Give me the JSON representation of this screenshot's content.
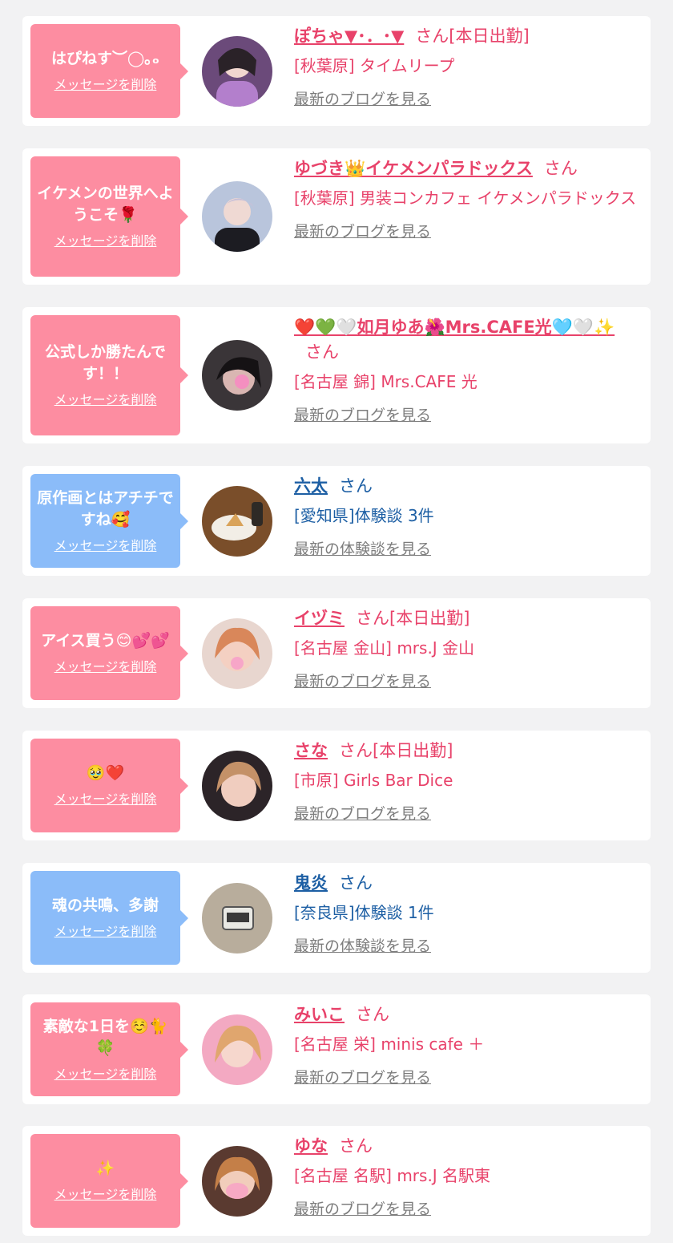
{
  "entries": [
    {
      "message": "はぴねす︶◯｡ₒ",
      "delete_label": "メッセージを削除",
      "name": "ぽちゃ▼･．･▼",
      "suffix": "さん[本日出勤]",
      "shop": "[秋葉原] タイムリープ",
      "link": "最新のブログを見る",
      "theme": "pink"
    },
    {
      "message": "イケメンの世界へようこそ🌹",
      "delete_label": "メッセージを削除",
      "name": "ゆづき👑イケメンパラドックス",
      "suffix": "さん",
      "shop": "[秋葉原] 男装コンカフェ イケメンパラドックス",
      "link": "最新のブログを見る",
      "theme": "pink"
    },
    {
      "message": "公式しか勝たんです！！",
      "delete_label": "メッセージを削除",
      "name": "❤️💚🤍如月ゆあ🌺Mrs.CAFE光🩵🤍✨",
      "suffix": "さん",
      "shop": "[名古屋 錦] Mrs.CAFE 光",
      "link": "最新のブログを見る",
      "theme": "pink"
    },
    {
      "message": "原作画とはアチチですね🥰",
      "delete_label": "メッセージを削除",
      "name": "六太",
      "suffix": "さん",
      "shop": "[愛知県]体験談 3件",
      "link": "最新の体験談を見る",
      "theme": "blue"
    },
    {
      "message": "アイス買う😊💕💕",
      "delete_label": "メッセージを削除",
      "name": "イヅミ",
      "suffix": "さん[本日出勤]",
      "shop": "[名古屋 金山] mrs.J 金山",
      "link": "最新のブログを見る",
      "theme": "pink"
    },
    {
      "message": "🥹❤️",
      "delete_label": "メッセージを削除",
      "name": "さな",
      "suffix": "さん[本日出勤]",
      "shop": "[市原] Girls Bar Dice",
      "link": "最新のブログを見る",
      "theme": "pink"
    },
    {
      "message": "魂の共鳴、多謝",
      "delete_label": "メッセージを削除",
      "name": "鬼炎",
      "suffix": "さん",
      "shop": "[奈良県]体験談 1件",
      "link": "最新の体験談を見る",
      "theme": "blue"
    },
    {
      "message": "素敵な1日を☺️🐈🍀",
      "delete_label": "メッセージを削除",
      "name": "みいこ",
      "suffix": "さん",
      "shop": "[名古屋 栄] minis cafe ＋",
      "link": "最新のブログを見る",
      "theme": "pink"
    },
    {
      "message": "✨",
      "delete_label": "メッセージを削除",
      "name": "ゆな",
      "suffix": "さん",
      "shop": "[名古屋 名駅] mrs.J 名駅東",
      "link": "最新のブログを見る",
      "theme": "pink"
    }
  ],
  "colors": {
    "pink_bubble": "#fd8da1",
    "blue_bubble": "#8bbcf9",
    "pink_text": "#e8426a",
    "blue_text": "#1d5fa4",
    "link_gray": "#7d7d7d",
    "page_bg": "#f2f2f3"
  }
}
